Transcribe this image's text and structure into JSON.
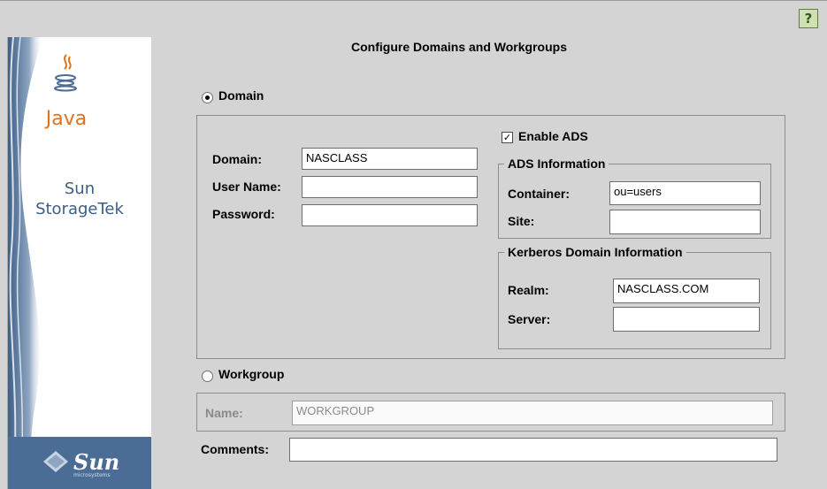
{
  "help": {
    "label": "?"
  },
  "brand": {
    "java_label": "Java",
    "product_line1": "Sun",
    "product_line2": "StorageTek",
    "sun_logo": "Sun",
    "sun_logo_sub": "microsystems"
  },
  "page": {
    "title": "Configure Domains and Workgroups"
  },
  "domain_section": {
    "radio_label": "Domain",
    "selected": true,
    "domain_label": "Domain:",
    "domain_value": "NASCLASS",
    "user_label": "User Name:",
    "user_value": "",
    "password_label": "Password:",
    "password_value": "",
    "enable_ads_label": "Enable ADS",
    "enable_ads_checked": true,
    "ads": {
      "legend": "ADS Information",
      "container_label": "Container:",
      "container_value": "ou=users",
      "site_label": "Site:",
      "site_value": ""
    },
    "kerberos": {
      "legend": "Kerberos Domain Information",
      "realm_label": "Realm:",
      "realm_value": "NASCLASS.COM",
      "server_label": "Server:",
      "server_value": ""
    }
  },
  "workgroup_section": {
    "radio_label": "Workgroup",
    "selected": false,
    "name_label": "Name:",
    "name_value": "WORKGROUP"
  },
  "comments": {
    "label": "Comments:",
    "value": ""
  },
  "colors": {
    "java_orange": "#e37117",
    "sun_blue": "#4b6c95",
    "panel_gray": "#d4d4d4",
    "help_green": "#cfe0b7"
  }
}
